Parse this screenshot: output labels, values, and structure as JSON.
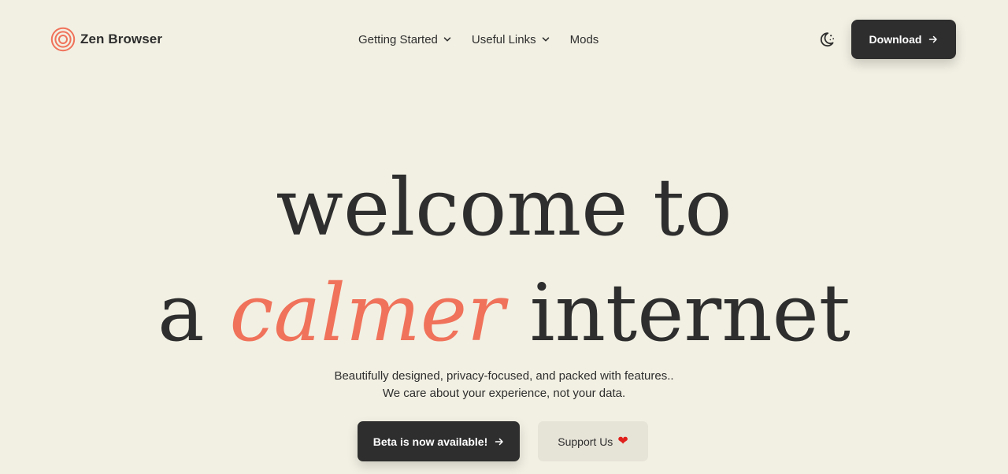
{
  "brand": {
    "name": "Zen Browser",
    "logo_icon": "zen-concentric-circles-icon",
    "accent_color": "#f0725a"
  },
  "nav": {
    "items": [
      {
        "label": "Getting Started",
        "has_dropdown": true
      },
      {
        "label": "Useful Links",
        "has_dropdown": true
      },
      {
        "label": "Mods",
        "has_dropdown": false
      }
    ]
  },
  "header": {
    "theme_toggle_icon": "moon-stars-icon",
    "download_label": "Download"
  },
  "hero": {
    "line1": "welcome to",
    "line2_prefix": "a",
    "line2_accent": "calmer",
    "line2_suffix": "internet",
    "subtitle_1": "Beautifully designed, privacy-focused, and packed with features..",
    "subtitle_2": "We care about your experience, not your data.",
    "primary_cta": "Beta is now available!",
    "secondary_cta": "Support Us",
    "secondary_cta_icon": "heart-icon",
    "secondary_cta_glyph": "❤"
  },
  "colors": {
    "background": "#f2f0e3",
    "text": "#2e2e2e",
    "accent": "#f0725a",
    "button_dark": "#2e2e2e",
    "button_light": "#e6e3d7",
    "heart": "#e0201c"
  }
}
